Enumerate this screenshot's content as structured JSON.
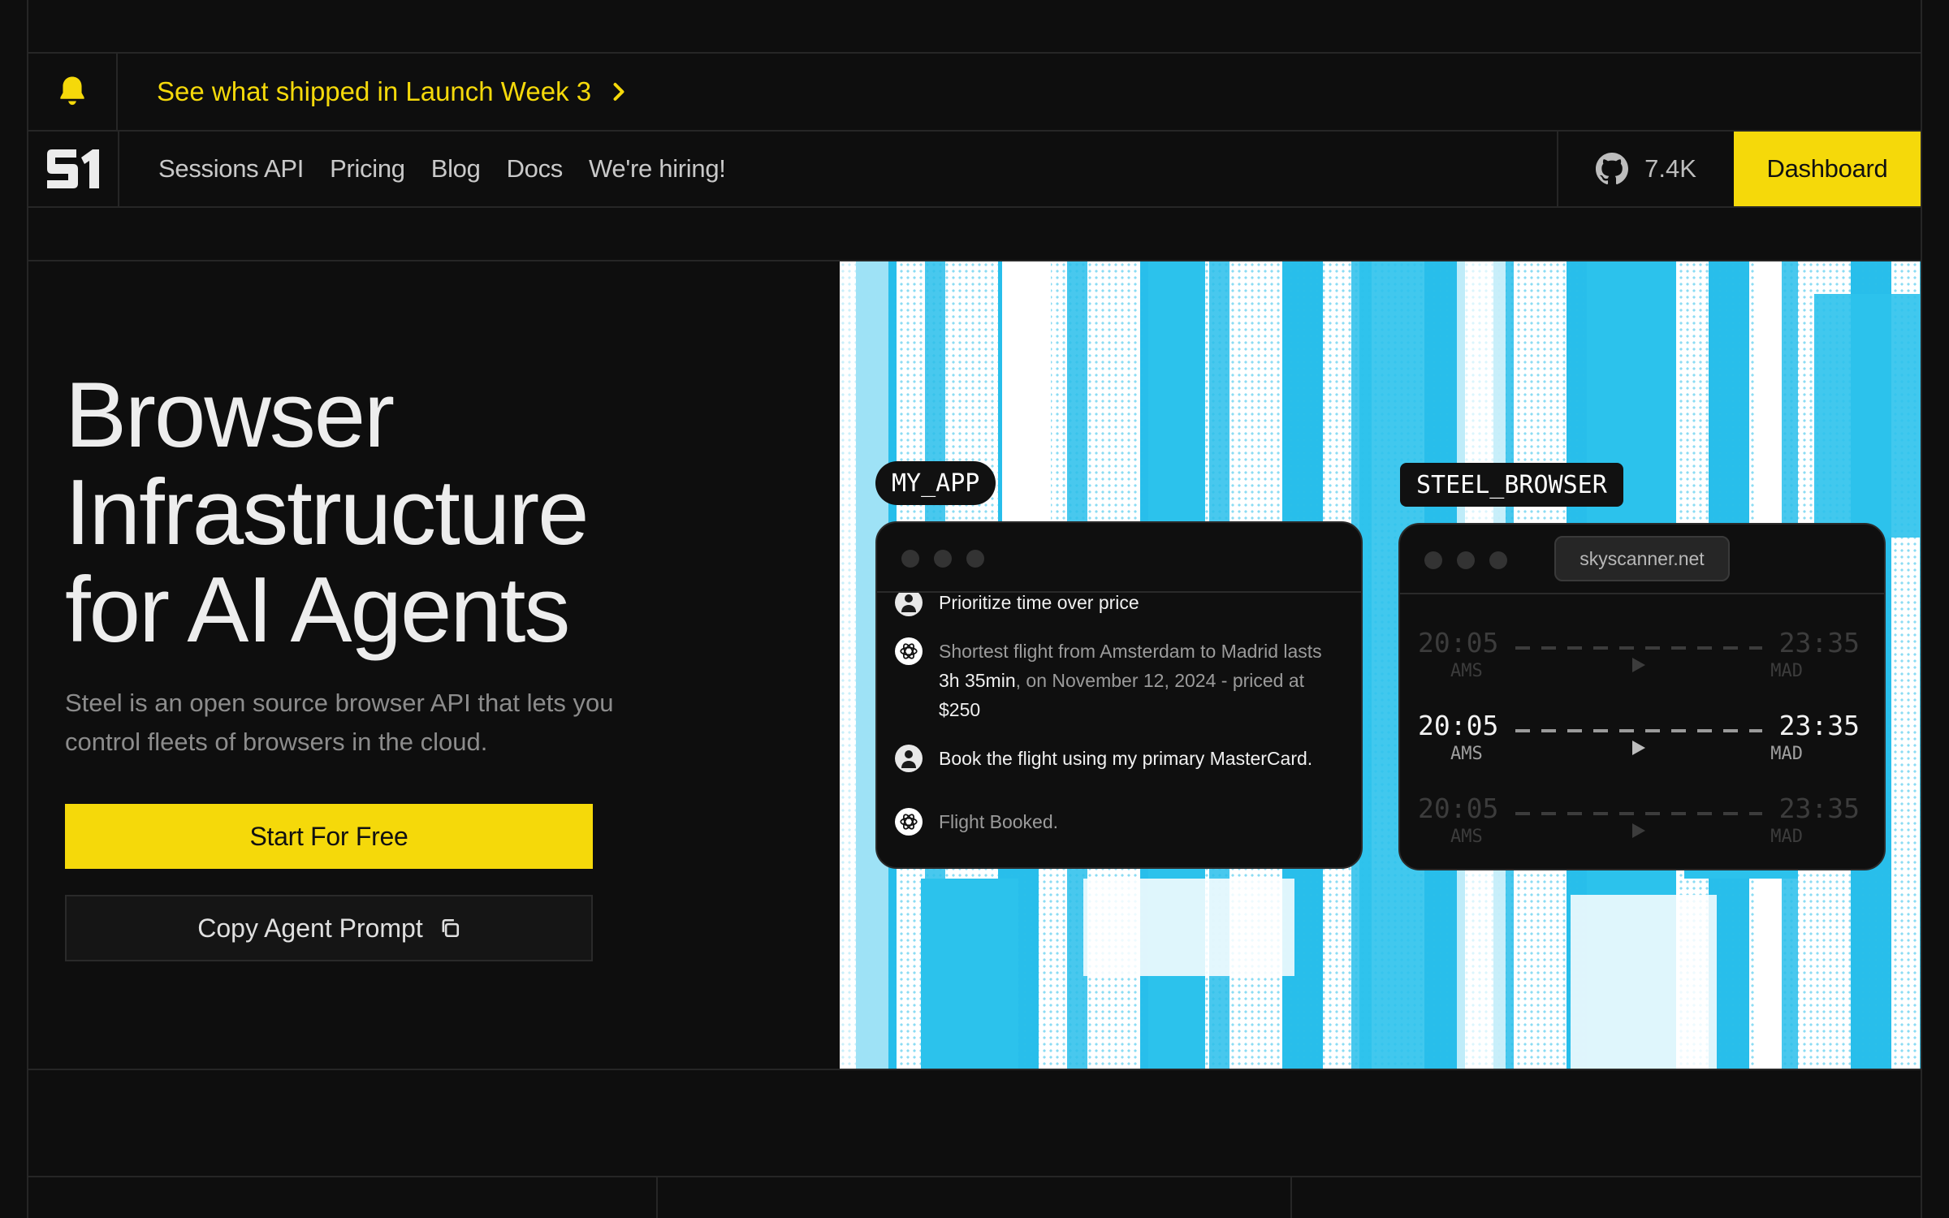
{
  "announcement": {
    "text": "See what shipped in Launch Week 3"
  },
  "nav": {
    "links": [
      "Sessions API",
      "Pricing",
      "Blog",
      "Docs",
      "We're hiring!"
    ],
    "github_stars": "7.4K",
    "dashboard_label": "Dashboard"
  },
  "hero": {
    "title": "Browser\nInfrastructure\nfor AI Agents",
    "subtitle": "Steel is an open source browser API that lets you control fleets of browsers in the cloud.",
    "primary_cta": "Start For Free",
    "secondary_cta": "Copy Agent Prompt"
  },
  "demo": {
    "app_tag": "MY_APP",
    "browser_tag": "STEEL_BROWSER",
    "messages": [
      {
        "role": "user",
        "text": "Prioritize time over price"
      },
      {
        "role": "bot",
        "parts": [
          "Shortest flight from Amsterdam to Madrid lasts ",
          "3h 35min",
          ", on November 12, 2024 - priced at ",
          "$250"
        ]
      },
      {
        "role": "user",
        "text": "Book the flight using my primary MasterCard."
      },
      {
        "role": "bot",
        "text": "Flight Booked."
      }
    ],
    "browser_url": "skyscanner.net",
    "flights": [
      {
        "dep_time": "20:05",
        "dep_code": "AMS",
        "arr_time": "23:35",
        "arr_code": "MAD"
      },
      {
        "dep_time": "20:05",
        "dep_code": "AMS",
        "arr_time": "23:35",
        "arr_code": "MAD"
      },
      {
        "dep_time": "20:05",
        "dep_code": "AMS",
        "arr_time": "23:35",
        "arr_code": "MAD"
      }
    ]
  },
  "colors": {
    "accent": "#f5d90a",
    "background": "#0e0e0e",
    "art_blue": "#2cc2ec"
  }
}
